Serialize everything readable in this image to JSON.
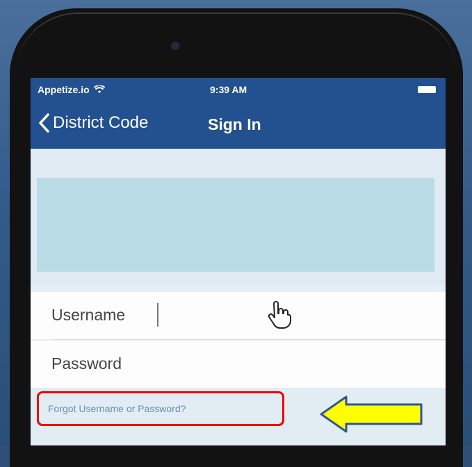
{
  "status_bar": {
    "carrier": "Appetize.io",
    "time": "9:39 AM"
  },
  "nav": {
    "back_label": "District Code",
    "title": "Sign In"
  },
  "form": {
    "username_label": "Username",
    "password_label": "Password",
    "forgot_link": "Forgot Username or Password?"
  },
  "annotations": {
    "highlight_color": "#f00000",
    "arrow_fill": "#ffff00",
    "arrow_stroke": "#2f5597"
  },
  "colors": {
    "nav_background": "#23508f",
    "logo_placeholder": "#b9dce6",
    "link": "#6d8eb0"
  },
  "icons": [
    "wifi-icon",
    "battery-icon",
    "chevron-left-icon",
    "hand-cursor-icon"
  ]
}
